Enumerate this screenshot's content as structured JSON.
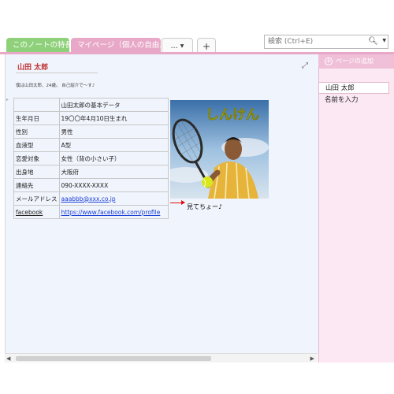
{
  "tabs": [
    {
      "label": "このノートの特長"
    },
    {
      "label": "マイページ（個人の自由..."
    }
  ],
  "tab_more_label": "... ▾",
  "tab_add_label": "+",
  "search": {
    "placeholder": "検索 (Ctrl+E)",
    "icon": "search-icon"
  },
  "page": {
    "title": "山田 太郎",
    "description": "僕は山田太郎、24歳。 自己紹介で～す♪",
    "table": {
      "header": "山田太郎の基本データ",
      "rows": [
        {
          "key": "生年月日",
          "value": "19〇〇年4月10日生まれ"
        },
        {
          "key": "性別",
          "value": "男性"
        },
        {
          "key": "血液型",
          "value": "A型"
        },
        {
          "key": "恋愛対象",
          "value": "女性（背の小さい子）"
        },
        {
          "key": "出身地",
          "value": "大阪府"
        },
        {
          "key": "連絡先",
          "value": "090-XXXX-XXXX"
        },
        {
          "key": "メールアドレス",
          "value": "aaabbb@xxx.co.jp"
        },
        {
          "key": "facebook",
          "value": "https://www.facebook.com/profile"
        }
      ]
    },
    "photo_caption": "しんけん",
    "note": "見てちょー♪"
  },
  "right_panel": {
    "add_page": "ページの追加",
    "pages": [
      {
        "label": "山田 太郎"
      },
      {
        "label": "名前を入力"
      }
    ]
  },
  "colors": {
    "tab_green": "#8fd17a",
    "tab_pink": "#e8a8c8",
    "title_red": "#c03030",
    "link_blue": "#1a3fd6",
    "arrow_red": "#e01010"
  }
}
